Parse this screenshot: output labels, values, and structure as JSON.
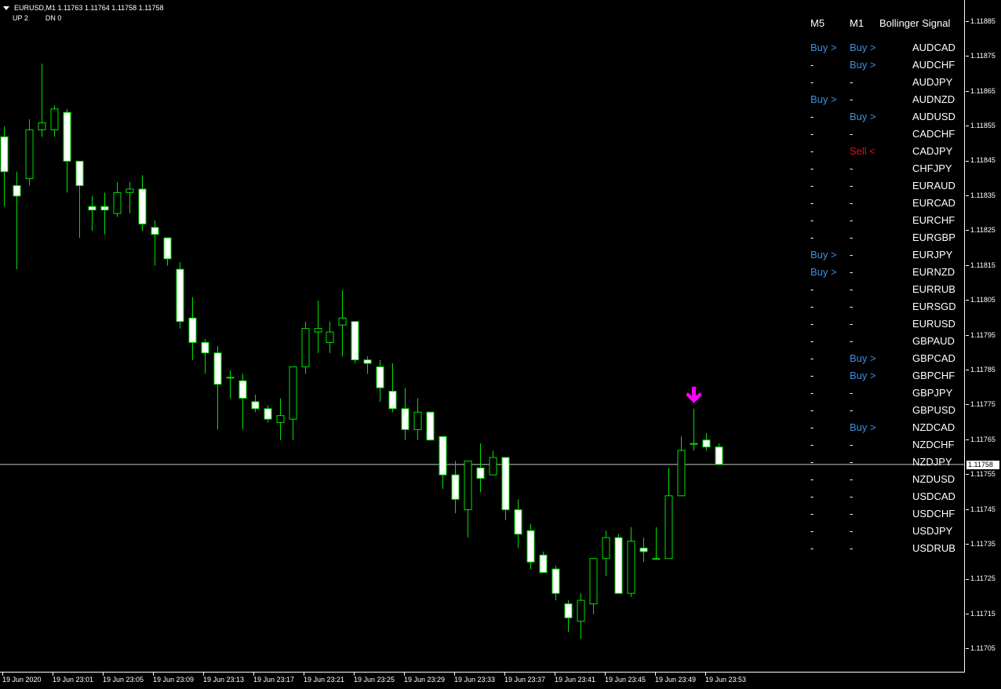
{
  "header": {
    "symbol_line": "EURUSD,M1  1.11763 1.11764 1.11758 1.11758",
    "up_label": "UP  2",
    "dn_label": "DN  0"
  },
  "price_axis": {
    "ticks": [
      "1.11885",
      "1.11875",
      "1.11865",
      "1.11855",
      "1.11845",
      "1.11835",
      "1.11825",
      "1.11815",
      "1.11805",
      "1.11795",
      "1.11785",
      "1.11775",
      "1.11765",
      "1.11755",
      "1.11745",
      "1.11735",
      "1.11725",
      "1.11715",
      "1.11705"
    ],
    "current_price": "1.11758"
  },
  "time_axis": {
    "labels": [
      "19 Jun 2020",
      "19 Jun 23:01",
      "19 Jun 23:05",
      "19 Jun 23:09",
      "19 Jun 23:13",
      "19 Jun 23:17",
      "19 Jun 23:21",
      "19 Jun 23:25",
      "19 Jun 23:29",
      "19 Jun 23:33",
      "19 Jun 23:37",
      "19 Jun 23:41",
      "19 Jun 23:45",
      "19 Jun 23:49",
      "19 Jun 23:53"
    ]
  },
  "signal_table": {
    "headers": {
      "m5": "M5",
      "m1": "M1",
      "title": "Bollinger Signal"
    },
    "colors": {
      "buy": "#3d8fe0",
      "sell": "#e01010",
      "neutral": "#ffffff"
    },
    "rows": [
      {
        "m5": "Buy >",
        "m1": "Buy >",
        "symbol": "AUDCAD"
      },
      {
        "m5": "-",
        "m1": "Buy >",
        "symbol": "AUDCHF"
      },
      {
        "m5": "-",
        "m1": "-",
        "symbol": "AUDJPY"
      },
      {
        "m5": "Buy >",
        "m1": "-",
        "symbol": "AUDNZD"
      },
      {
        "m5": "-",
        "m1": "Buy >",
        "symbol": "AUDUSD"
      },
      {
        "m5": "-",
        "m1": "-",
        "symbol": "CADCHF"
      },
      {
        "m5": "-",
        "m1": "Sell <",
        "symbol": "CADJPY"
      },
      {
        "m5": "-",
        "m1": "-",
        "symbol": "CHFJPY"
      },
      {
        "m5": "-",
        "m1": "-",
        "symbol": "EURAUD"
      },
      {
        "m5": "-",
        "m1": "-",
        "symbol": "EURCAD"
      },
      {
        "m5": "-",
        "m1": "-",
        "symbol": "EURCHF"
      },
      {
        "m5": "-",
        "m1": "-",
        "symbol": "EURGBP"
      },
      {
        "m5": "Buy >",
        "m1": "-",
        "symbol": "EURJPY"
      },
      {
        "m5": "Buy >",
        "m1": "-",
        "symbol": "EURNZD"
      },
      {
        "m5": "-",
        "m1": "-",
        "symbol": "EURRUB"
      },
      {
        "m5": "-",
        "m1": "-",
        "symbol": "EURSGD"
      },
      {
        "m5": "-",
        "m1": "-",
        "symbol": "EURUSD"
      },
      {
        "m5": "-",
        "m1": "-",
        "symbol": "GBPAUD"
      },
      {
        "m5": "-",
        "m1": "Buy >",
        "symbol": "GBPCAD"
      },
      {
        "m5": "-",
        "m1": "Buy >",
        "symbol": "GBPCHF"
      },
      {
        "m5": "-",
        "m1": "-",
        "symbol": "GBPJPY"
      },
      {
        "m5": "-",
        "m1": "-",
        "symbol": "GBPUSD"
      },
      {
        "m5": "-",
        "m1": "Buy >",
        "symbol": "NZDCAD"
      },
      {
        "m5": "-",
        "m1": "-",
        "symbol": "NZDCHF"
      },
      {
        "m5": "-",
        "m1": "-",
        "symbol": "NZDJPY"
      },
      {
        "m5": "-",
        "m1": "-",
        "symbol": "NZDUSD"
      },
      {
        "m5": "-",
        "m1": "-",
        "symbol": "USDCAD"
      },
      {
        "m5": "-",
        "m1": "-",
        "symbol": "USDCHF"
      },
      {
        "m5": "-",
        "m1": "-",
        "symbol": "USDJPY"
      },
      {
        "m5": "-",
        "m1": "-",
        "symbol": "USDRUB"
      }
    ]
  },
  "chart_data": {
    "type": "candlestick",
    "symbol": "EURUSD",
    "timeframe": "M1",
    "ylim": [
      1.11701,
      1.11889
    ],
    "bull_color": "#00e000",
    "bear_color": "#ffffff",
    "signal_arrow": {
      "candle_index": 55,
      "color": "#ff00ff",
      "direction": "down"
    },
    "candles": [
      {
        "o": 1.11852,
        "h": 1.11855,
        "l": 1.11832,
        "c": 1.11842
      },
      {
        "o": 1.11838,
        "h": 1.11842,
        "l": 1.11814,
        "c": 1.11835
      },
      {
        "o": 1.1184,
        "h": 1.11857,
        "l": 1.11838,
        "c": 1.11854
      },
      {
        "o": 1.11854,
        "h": 1.11873,
        "l": 1.11852,
        "c": 1.11856
      },
      {
        "o": 1.11854,
        "h": 1.11861,
        "l": 1.11852,
        "c": 1.1186
      },
      {
        "o": 1.11859,
        "h": 1.1186,
        "l": 1.11836,
        "c": 1.11845
      },
      {
        "o": 1.11845,
        "h": 1.11845,
        "l": 1.11823,
        "c": 1.11838
      },
      {
        "o": 1.11832,
        "h": 1.11835,
        "l": 1.11825,
        "c": 1.11831
      },
      {
        "o": 1.11832,
        "h": 1.11836,
        "l": 1.11824,
        "c": 1.11831
      },
      {
        "o": 1.1183,
        "h": 1.11839,
        "l": 1.11829,
        "c": 1.11836
      },
      {
        "o": 1.11836,
        "h": 1.11839,
        "l": 1.1183,
        "c": 1.11837
      },
      {
        "o": 1.11837,
        "h": 1.11841,
        "l": 1.11825,
        "c": 1.11827
      },
      {
        "o": 1.11826,
        "h": 1.11828,
        "l": 1.11815,
        "c": 1.11824
      },
      {
        "o": 1.11823,
        "h": 1.11823,
        "l": 1.11815,
        "c": 1.11817
      },
      {
        "o": 1.11814,
        "h": 1.11816,
        "l": 1.11797,
        "c": 1.11799
      },
      {
        "o": 1.118,
        "h": 1.11806,
        "l": 1.11788,
        "c": 1.11793
      },
      {
        "o": 1.11793,
        "h": 1.11794,
        "l": 1.11784,
        "c": 1.1179
      },
      {
        "o": 1.1179,
        "h": 1.11792,
        "l": 1.11768,
        "c": 1.11781
      },
      {
        "o": 1.11783,
        "h": 1.11785,
        "l": 1.11777,
        "c": 1.11783
      },
      {
        "o": 1.11782,
        "h": 1.11784,
        "l": 1.11768,
        "c": 1.11777
      },
      {
        "o": 1.11776,
        "h": 1.11778,
        "l": 1.11773,
        "c": 1.11774
      },
      {
        "o": 1.11774,
        "h": 1.11775,
        "l": 1.1177,
        "c": 1.11771
      },
      {
        "o": 1.1177,
        "h": 1.11777,
        "l": 1.11765,
        "c": 1.11772
      },
      {
        "o": 1.11771,
        "h": 1.11784,
        "l": 1.11765,
        "c": 1.11786
      },
      {
        "o": 1.11786,
        "h": 1.11799,
        "l": 1.11784,
        "c": 1.11797
      },
      {
        "o": 1.11796,
        "h": 1.11805,
        "l": 1.1179,
        "c": 1.11797
      },
      {
        "o": 1.11793,
        "h": 1.11799,
        "l": 1.1179,
        "c": 1.11796
      },
      {
        "o": 1.11798,
        "h": 1.11808,
        "l": 1.11789,
        "c": 1.118
      },
      {
        "o": 1.11799,
        "h": 1.11799,
        "l": 1.11787,
        "c": 1.11788
      },
      {
        "o": 1.11788,
        "h": 1.11789,
        "l": 1.11784,
        "c": 1.11787
      },
      {
        "o": 1.11786,
        "h": 1.11788,
        "l": 1.11776,
        "c": 1.1178
      },
      {
        "o": 1.11779,
        "h": 1.11787,
        "l": 1.11773,
        "c": 1.11774
      },
      {
        "o": 1.11774,
        "h": 1.1178,
        "l": 1.11765,
        "c": 1.11768
      },
      {
        "o": 1.11768,
        "h": 1.11777,
        "l": 1.11765,
        "c": 1.11773
      },
      {
        "o": 1.11773,
        "h": 1.11773,
        "l": 1.11765,
        "c": 1.11765
      },
      {
        "o": 1.11766,
        "h": 1.11766,
        "l": 1.11751,
        "c": 1.11755
      },
      {
        "o": 1.11755,
        "h": 1.11759,
        "l": 1.11744,
        "c": 1.11748
      },
      {
        "o": 1.11745,
        "h": 1.11747,
        "l": 1.11737,
        "c": 1.11759
      },
      {
        "o": 1.11757,
        "h": 1.11764,
        "l": 1.1175,
        "c": 1.11754
      },
      {
        "o": 1.11755,
        "h": 1.11762,
        "l": 1.11755,
        "c": 1.1176
      },
      {
        "o": 1.1176,
        "h": 1.1176,
        "l": 1.11742,
        "c": 1.11745
      },
      {
        "o": 1.11745,
        "h": 1.11748,
        "l": 1.11734,
        "c": 1.11738
      },
      {
        "o": 1.11739,
        "h": 1.11741,
        "l": 1.11728,
        "c": 1.1173
      },
      {
        "o": 1.11732,
        "h": 1.11733,
        "l": 1.1173,
        "c": 1.11727
      },
      {
        "o": 1.11728,
        "h": 1.11729,
        "l": 1.11719,
        "c": 1.11721
      },
      {
        "o": 1.11718,
        "h": 1.11719,
        "l": 1.1171,
        "c": 1.11714
      },
      {
        "o": 1.11713,
        "h": 1.11721,
        "l": 1.11708,
        "c": 1.11719
      },
      {
        "o": 1.11718,
        "h": 1.11729,
        "l": 1.11715,
        "c": 1.11731
      },
      {
        "o": 1.11731,
        "h": 1.11739,
        "l": 1.11726,
        "c": 1.11737
      },
      {
        "o": 1.11737,
        "h": 1.11738,
        "l": 1.11725,
        "c": 1.11721
      },
      {
        "o": 1.11721,
        "h": 1.1174,
        "l": 1.1172,
        "c": 1.11736
      },
      {
        "o": 1.11734,
        "h": 1.11737,
        "l": 1.1173,
        "c": 1.11733
      },
      {
        "o": 1.11731,
        "h": 1.1174,
        "l": 1.11731,
        "c": 1.11731
      },
      {
        "o": 1.11731,
        "h": 1.11757,
        "l": 1.11731,
        "c": 1.11749
      },
      {
        "o": 1.11749,
        "h": 1.11766,
        "l": 1.1175,
        "c": 1.11762
      },
      {
        "o": 1.11764,
        "h": 1.11774,
        "l": 1.11762,
        "c": 1.11764
      },
      {
        "o": 1.11765,
        "h": 1.11767,
        "l": 1.11762,
        "c": 1.11763
      },
      {
        "o": 1.11763,
        "h": 1.11764,
        "l": 1.11758,
        "c": 1.11758
      }
    ]
  }
}
